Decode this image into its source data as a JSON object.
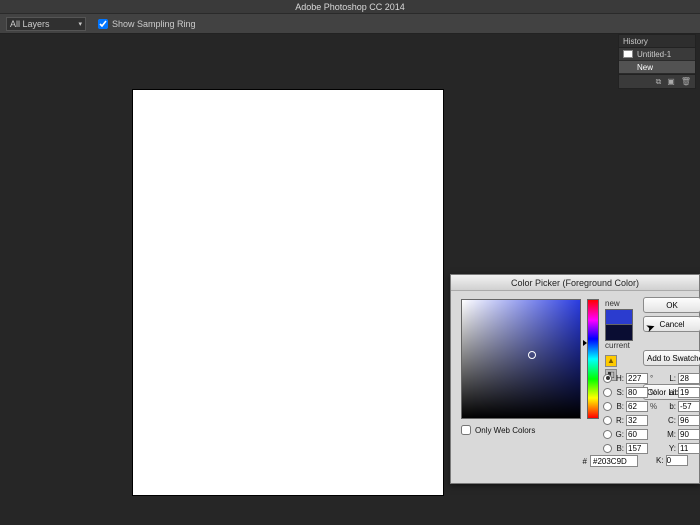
{
  "app": {
    "title": "Adobe Photoshop CC 2014"
  },
  "optionbar": {
    "sample_label": "",
    "sample_dropdown": "All Layers",
    "show_ring": "Show Sampling Ring"
  },
  "history": {
    "tab": "History",
    "doc": "Untitled-1",
    "state": "New",
    "foot_icons": [
      "reel-icon",
      "new-icon",
      "trash-icon"
    ]
  },
  "picker": {
    "title": "Color Picker (Foreground Color)",
    "buttons": {
      "ok": "OK",
      "cancel": "Cancel",
      "add": "Add to Swatches",
      "libs": "Color Libraries"
    },
    "swatch": {
      "new_label": "new",
      "current_label": "current"
    },
    "web_colors": "Only Web Colors",
    "fields": {
      "H": "227",
      "S": "80",
      "B": "62",
      "R": "32",
      "G": "60",
      "Bl": "157",
      "L": "28",
      "a": "19",
      "b": "-57",
      "C": "96",
      "M": "90",
      "Y": "11",
      "K": "0"
    },
    "hex": "#203C9D"
  }
}
